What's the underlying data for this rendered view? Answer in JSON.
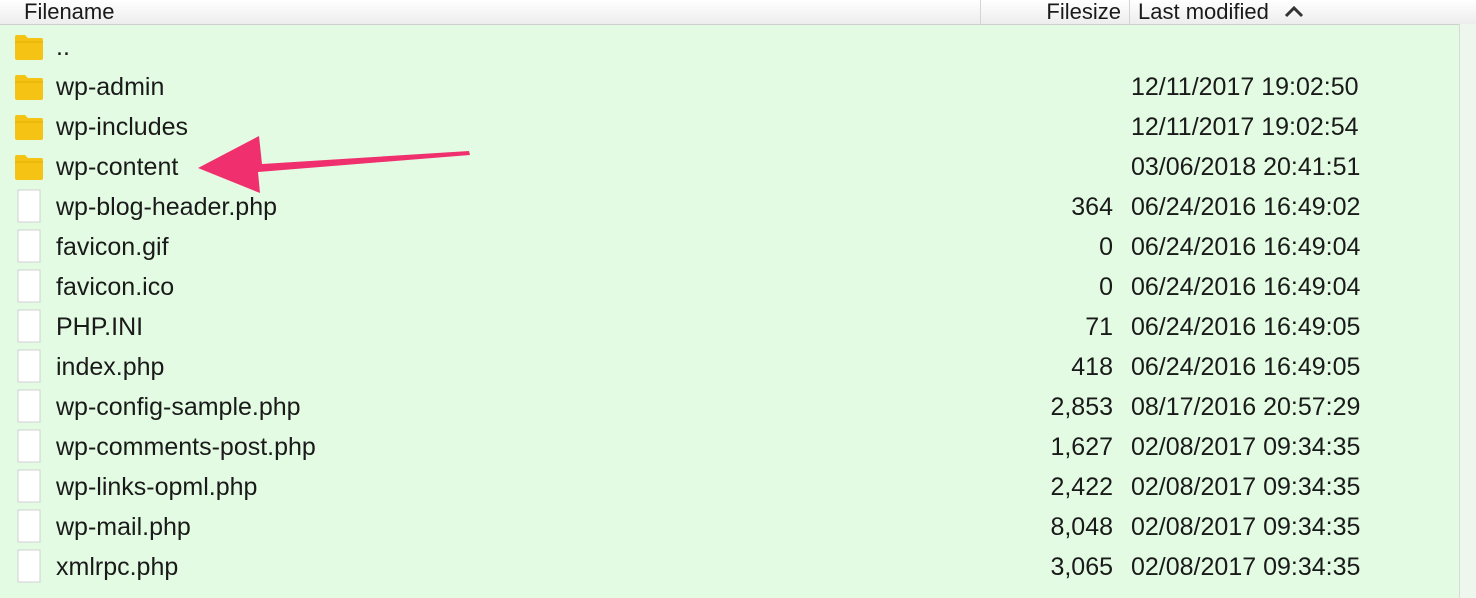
{
  "header": {
    "filename": "Filename",
    "filesize": "Filesize",
    "last_modified": "Last modified",
    "sort_caret": "^"
  },
  "colors": {
    "row_bg": "#e3fbe3",
    "folder": "#f5c313",
    "arrow": "#f0306e"
  },
  "rows": [
    {
      "name": "..",
      "size": "",
      "modified": "",
      "icon": "folder-icon"
    },
    {
      "name": "wp-admin",
      "size": "",
      "modified": "12/11/2017 19:02:50",
      "icon": "folder-icon"
    },
    {
      "name": "wp-includes",
      "size": "",
      "modified": "12/11/2017 19:02:54",
      "icon": "folder-icon"
    },
    {
      "name": "wp-content",
      "size": "",
      "modified": "03/06/2018 20:41:51",
      "icon": "folder-icon"
    },
    {
      "name": "wp-blog-header.php",
      "size": "364",
      "modified": "06/24/2016 16:49:02",
      "icon": "file-icon"
    },
    {
      "name": "favicon.gif",
      "size": "0",
      "modified": "06/24/2016 16:49:04",
      "icon": "file-icon"
    },
    {
      "name": "favicon.ico",
      "size": "0",
      "modified": "06/24/2016 16:49:04",
      "icon": "file-icon"
    },
    {
      "name": "PHP.INI",
      "size": "71",
      "modified": "06/24/2016 16:49:05",
      "icon": "file-icon"
    },
    {
      "name": "index.php",
      "size": "418",
      "modified": "06/24/2016 16:49:05",
      "icon": "file-icon"
    },
    {
      "name": "wp-config-sample.php",
      "size": "2,853",
      "modified": "08/17/2016 20:57:29",
      "icon": "file-icon"
    },
    {
      "name": "wp-comments-post.php",
      "size": "1,627",
      "modified": "02/08/2017 09:34:35",
      "icon": "file-icon"
    },
    {
      "name": "wp-links-opml.php",
      "size": "2,422",
      "modified": "02/08/2017 09:34:35",
      "icon": "file-icon"
    },
    {
      "name": "wp-mail.php",
      "size": "8,048",
      "modified": "02/08/2017 09:34:35",
      "icon": "file-icon"
    },
    {
      "name": "xmlrpc.php",
      "size": "3,065",
      "modified": "02/08/2017 09:34:35",
      "icon": "file-icon"
    }
  ]
}
